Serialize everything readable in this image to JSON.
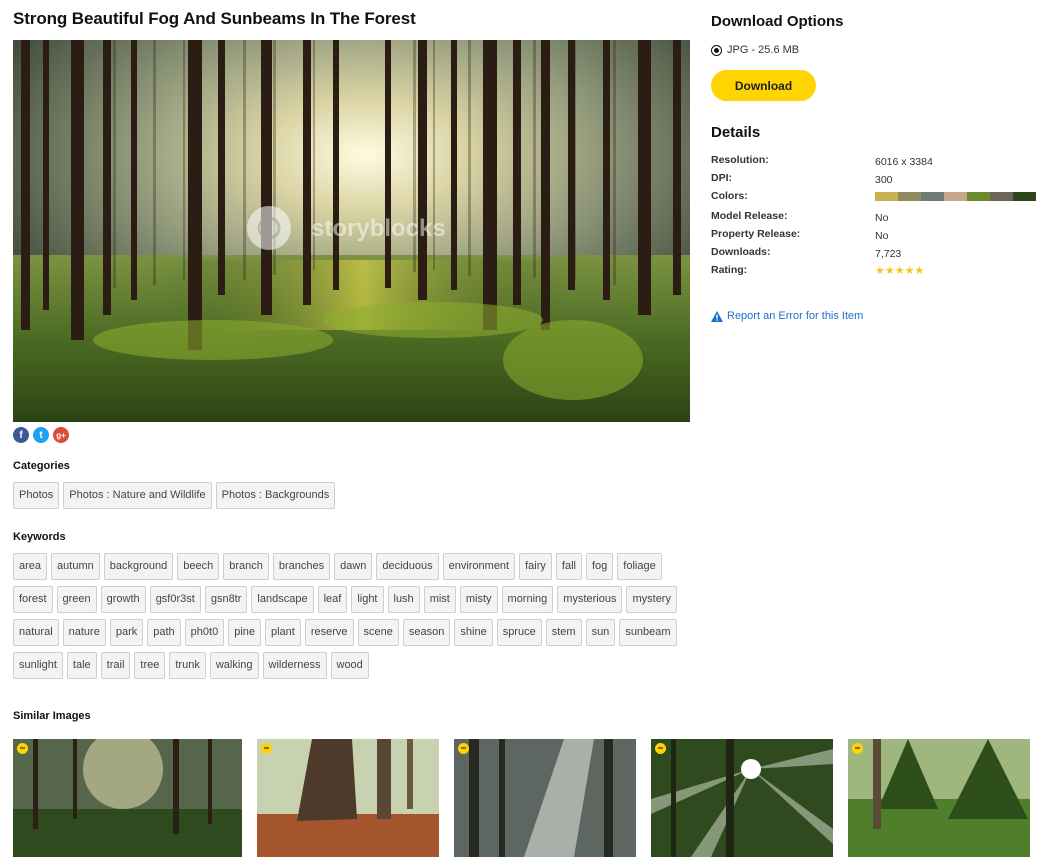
{
  "page": {
    "title": "Strong Beautiful Fog And Sunbeams In The Forest",
    "watermark": "storyblocks"
  },
  "share": {
    "facebook_glyph": "f",
    "twitter_glyph": "t",
    "google_glyph": "g+"
  },
  "categories": {
    "heading": "Categories",
    "items": [
      "Photos",
      "Photos : Nature and Wildlife",
      "Photos : Backgrounds"
    ]
  },
  "keywords": {
    "heading": "Keywords",
    "items": [
      "area",
      "autumn",
      "background",
      "beech",
      "branch",
      "branches",
      "dawn",
      "deciduous",
      "environment",
      "fairy",
      "fall",
      "fog",
      "foliage",
      "forest",
      "green",
      "growth",
      "gsf0r3st",
      "gsn8tr",
      "landscape",
      "leaf",
      "light",
      "lush",
      "mist",
      "misty",
      "morning",
      "mysterious",
      "mystery",
      "natural",
      "nature",
      "park",
      "path",
      "ph0t0",
      "pine",
      "plant",
      "reserve",
      "scene",
      "season",
      "shine",
      "spruce",
      "stem",
      "sun",
      "sunbeam",
      "sunlight",
      "tale",
      "trail",
      "tree",
      "trunk",
      "walking",
      "wilderness",
      "wood"
    ]
  },
  "similar": {
    "heading": "Similar Images",
    "badge_glyph": "∞",
    "items": [
      {
        "icon": "misty-forest-thumbnail"
      },
      {
        "icon": "autumn-trunk-thumbnail"
      },
      {
        "icon": "sunbeam-fog-thumbnail"
      },
      {
        "icon": "sunburst-forest-thumbnail"
      },
      {
        "icon": "green-forest-path-thumbnail"
      }
    ]
  },
  "download_options": {
    "heading": "Download Options",
    "format": "JPG - 25.6 MB",
    "button_label": "Download",
    "accent_color": "#ffd400"
  },
  "details": {
    "heading": "Details",
    "resolution_label": "Resolution:",
    "resolution_value": "6016 x 3384",
    "dpi_label": "DPI:",
    "dpi_value": "300",
    "colors_label": "Colors:",
    "colors": [
      "#c8b14e",
      "#8e8a5c",
      "#6e7a73",
      "#c6a98a",
      "#6b8a2f",
      "#6d6356",
      "#2f451a"
    ],
    "model_release_label": "Model Release:",
    "model_release_value": "No",
    "property_release_label": "Property Release:",
    "property_release_value": "No",
    "downloads_label": "Downloads:",
    "downloads_value": "7,723",
    "rating_label": "Rating:",
    "rating_stars": 5,
    "rating_glyphs": "★★★★★"
  },
  "report": {
    "label": "Report an Error for this Item",
    "color": "#1a6fd0"
  }
}
